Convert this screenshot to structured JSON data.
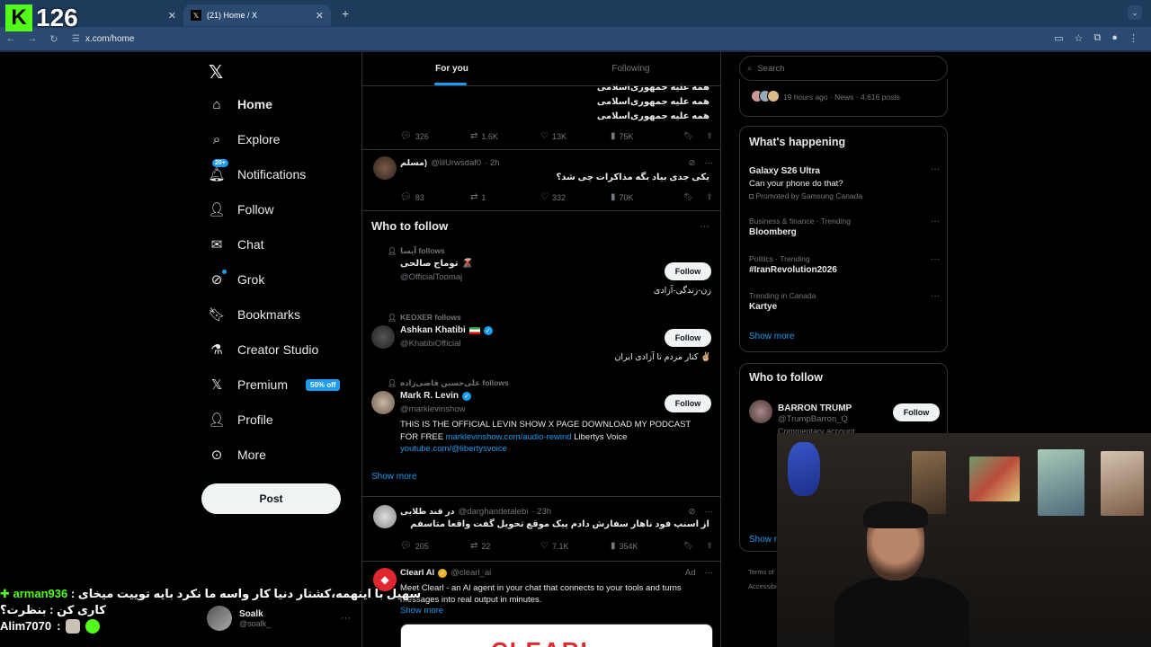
{
  "overlay": {
    "viewer_count": "126"
  },
  "browser": {
    "tabs": [
      {
        "title": "",
        "active": false
      },
      {
        "title": "(21) Home / X",
        "active": true
      }
    ],
    "url": "x.com/home"
  },
  "nav": {
    "items": [
      {
        "label": "Home",
        "icon": "home-icon"
      },
      {
        "label": "Explore",
        "icon": "search-icon"
      },
      {
        "label": "Notifications",
        "icon": "bell-icon",
        "badge": "20+"
      },
      {
        "label": "Follow",
        "icon": "person-plus-icon"
      },
      {
        "label": "Chat",
        "icon": "envelope-icon"
      },
      {
        "label": "Grok",
        "icon": "grok-icon"
      },
      {
        "label": "Bookmarks",
        "icon": "bookmark-icon"
      },
      {
        "label": "Creator Studio",
        "icon": "flask-icon"
      },
      {
        "label": "Premium",
        "icon": "x-icon",
        "badge": "50% off"
      },
      {
        "label": "Profile",
        "icon": "person-icon"
      },
      {
        "label": "More",
        "icon": "more-circle-icon"
      }
    ],
    "post_label": "Post",
    "account": {
      "name": "Soalk",
      "handle": "@soalk_"
    }
  },
  "feed": {
    "tabs": [
      "For you",
      "Following"
    ],
    "tweet1": {
      "lines": [
        "همه علیه جمهوری‌اسلامی",
        "همه علیه جمهوری‌اسلامی",
        "همه علیه جمهوری‌اسلامی"
      ],
      "replies": "326",
      "reposts": "1.6K",
      "likes": "13K",
      "views": "75K"
    },
    "tweet2": {
      "name": "مسلم)",
      "handle": "@lilUrwsdaf0",
      "time": "· 2h",
      "text": "یکی جدی بیاد بگه مذاکرات چی شد؟",
      "replies": "83",
      "reposts": "1",
      "likes": "332",
      "views": "70K"
    },
    "who_to_follow": {
      "title": "Who to follow",
      "people": [
        {
          "context": "آیسا follows",
          "name": "توماج صالحی",
          "handle": "@OfficialToomaj",
          "bio": "زن-زندگی-آزادی",
          "follow": "Follow"
        },
        {
          "context": "KEOXER follows",
          "name": "Ashkan Khatibi",
          "handle": "@KhatibiOfficial",
          "bio": "✌🏼 کنار مردم تا آزادی ایران",
          "follow": "Follow"
        },
        {
          "context": "علی‌حسین قاضی‌زاده follows",
          "name": "Mark R. Levin",
          "handle": "@marklevinshow",
          "bio": "THIS IS THE OFFICIAL LEVIN SHOW X PAGE DOWNLOAD MY PODCAST FOR FREE",
          "link1": "marklevinshow.com/audio-rewind",
          "bio_mid": "Libertys Voice",
          "link2": "youtube.com/@libertysvoice",
          "follow": "Follow"
        }
      ],
      "show_more": "Show more"
    },
    "tweet3": {
      "name": "در قند طلایی",
      "handle": "@darghandetalebi",
      "time": "· 23h",
      "text": "از اسنپ فود ناهار سفارش دادم پیک موقع تحویل گفت واقعا متاسفم",
      "replies": "205",
      "reposts": "22",
      "likes": "7.1K",
      "views": "354K"
    },
    "ad": {
      "name": "Clearl AI",
      "handle": "@clearl_ai",
      "tag": "Ad",
      "text": "Meet Clearl - an AI agent in your chat that connects to your tools and turns messages into real output in minutes.",
      "show_more": "Show more",
      "card_text": "CLEARL"
    }
  },
  "right": {
    "search_placeholder": "Search",
    "news_meta": "19 hours ago · News · 4,616 posts",
    "happening": {
      "title": "What's happening",
      "trends": [
        {
          "top": "",
          "name": "Galaxy S26 Ultra",
          "sub": "Can your phone do that?",
          "promo": "Promoted by Samsung Canada"
        },
        {
          "top": "Business & finance · Trending",
          "name": "Bloomberg"
        },
        {
          "top": "Politics · Trending",
          "name": "#IranRevolution2026"
        },
        {
          "top": "Trending in Canada",
          "name": "Kartye"
        }
      ],
      "show_more": "Show more"
    },
    "who_to_follow": {
      "title": "Who to follow",
      "people": [
        {
          "name": "BARRON TRUMP",
          "handle": "@TrumpBarron_Q",
          "note": "Commentary account",
          "follow": "Follow"
        }
      ],
      "show_more": "Show m"
    },
    "footer": [
      "Terms of",
      "Accessibi"
    ]
  },
  "chat": {
    "messages": [
      {
        "user": "arman936",
        "text": "سهیل با اینهمه،کشتار دنیا کار واسه ما نکرد بایه توییت میخای کاری کن : بنظرت؟"
      },
      {
        "user": "Alim7070",
        "text": ""
      }
    ]
  },
  "colors": {
    "accent": "#1d9bf0",
    "kick_green": "#53fc18",
    "background": "#000000",
    "border": "#2f3336"
  }
}
